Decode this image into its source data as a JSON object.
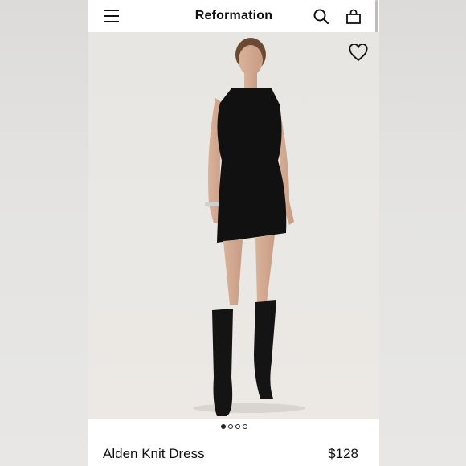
{
  "header": {
    "brand": "Reformation",
    "menu_icon": "hamburger-menu-icon",
    "search_icon": "search-icon",
    "bag_icon": "shopping-bag-icon"
  },
  "gallery": {
    "favorite_icon": "heart-outline-icon",
    "image_count": 4,
    "active_index": 0
  },
  "product": {
    "name": "Alden Knit Dress",
    "price": "$128"
  },
  "colors": {
    "background": "#e6e5e3",
    "photo_bg": "#e9e7e3",
    "text": "#111111",
    "dress": "#111111"
  }
}
